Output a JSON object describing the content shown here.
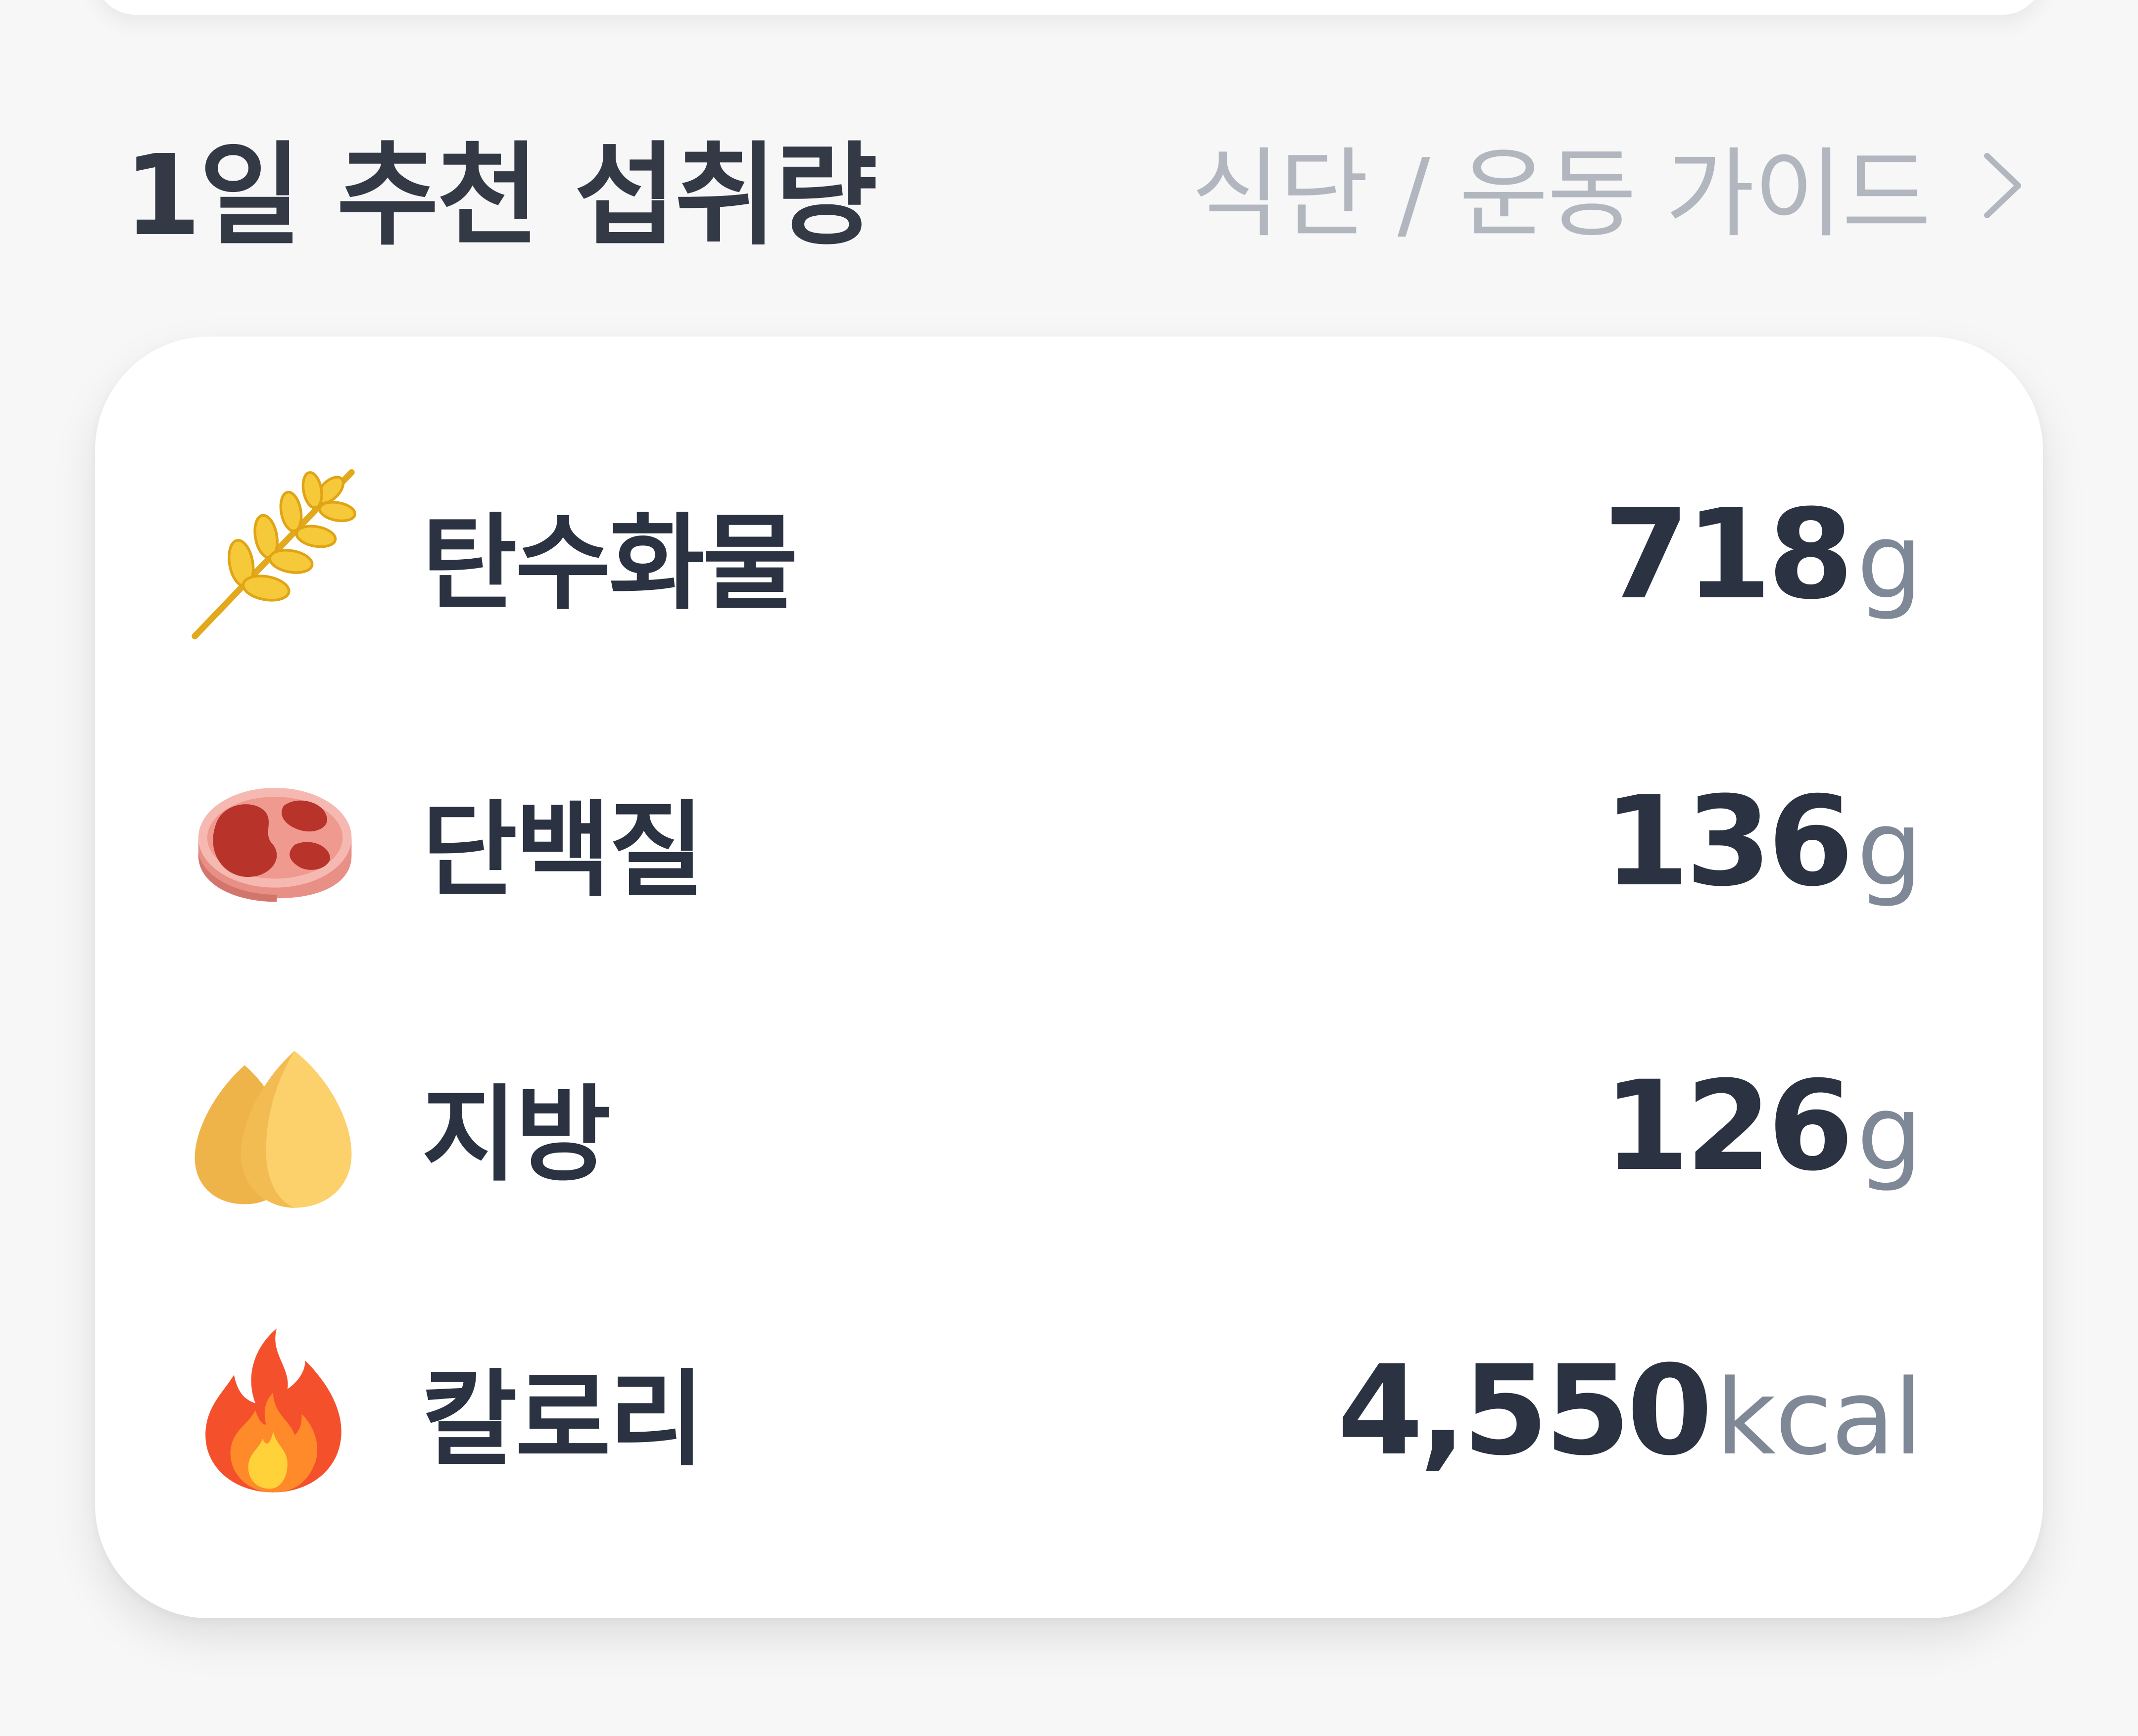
{
  "header": {
    "title": "1일 추천 섭취량",
    "guide_link_label": "식단 / 운동 가이드"
  },
  "nutrients": [
    {
      "label": "탄수화물",
      "value": "718",
      "unit": "g",
      "icon": "wheat-icon"
    },
    {
      "label": "단백질",
      "value": "136",
      "unit": "g",
      "icon": "meat-icon"
    },
    {
      "label": "지방",
      "value": "126",
      "unit": "g",
      "icon": "nut-icon"
    },
    {
      "label": "칼로리",
      "value": "4,550",
      "unit": "kcal",
      "icon": "fire-icon"
    }
  ],
  "colors": {
    "text_primary": "#2b3242",
    "text_unit": "#7e8896",
    "link_gray": "#b2b7bf",
    "background": "#f7f7f8",
    "card": "#ffffff"
  }
}
